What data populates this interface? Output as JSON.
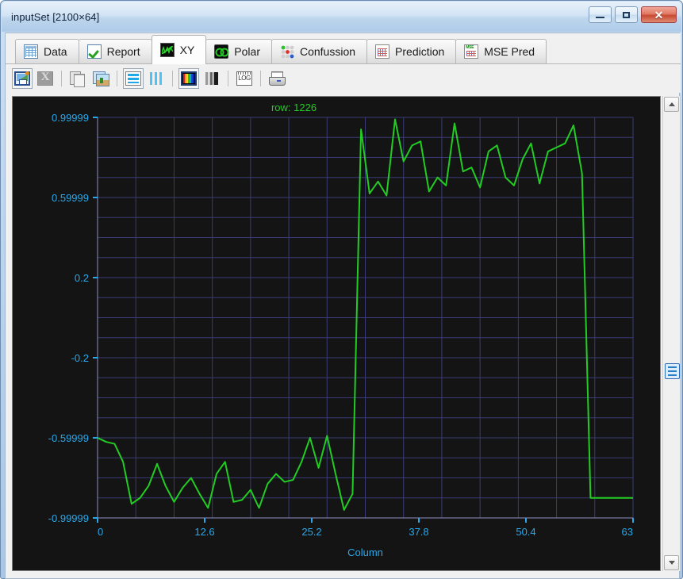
{
  "window": {
    "title": "inputSet [2100×64]",
    "buttons": [
      {
        "name": "minimize",
        "label": "Minimize",
        "glyph": "minimize-icon"
      },
      {
        "name": "maximize",
        "label": "Maximize",
        "glyph": "maximize-icon"
      },
      {
        "name": "close",
        "label": "Close",
        "glyph": "✕"
      }
    ]
  },
  "tabs": [
    {
      "label": "Data",
      "icon": "grid-table-icon",
      "active": false
    },
    {
      "label": "Report",
      "icon": "check-icon",
      "active": false
    },
    {
      "label": "XY",
      "icon": "waveform-icon",
      "active": true
    },
    {
      "label": "Polar",
      "icon": "polar-icon",
      "active": false
    },
    {
      "label": "Confussion",
      "icon": "confusion-dots-icon",
      "active": false
    },
    {
      "label": "Prediction",
      "icon": "prediction-grid-icon",
      "active": false
    },
    {
      "label": "MSE Pred",
      "icon": "mse-grid-icon",
      "active": false
    }
  ],
  "toolbar": {
    "buttons": [
      {
        "name": "save-image-button",
        "icon": "save-image-icon",
        "tooltip": "Save image"
      },
      {
        "name": "export-excel-button",
        "icon": "excel-icon",
        "tooltip": "Export to Excel",
        "disabled": true
      },
      {
        "name": "copy-button",
        "icon": "copy-icon",
        "tooltip": "Copy"
      },
      {
        "name": "copy-image-button",
        "icon": "copy-image-icon",
        "tooltip": "Copy image"
      },
      {
        "name": "rows-view-button",
        "icon": "horizontal-lines-icon",
        "tooltip": "Rows"
      },
      {
        "name": "columns-view-button",
        "icon": "vertical-bars-icon",
        "tooltip": "Columns"
      },
      {
        "name": "color-map-button",
        "icon": "color-bars-icon",
        "tooltip": "Color map",
        "selected": true
      },
      {
        "name": "gray-map-button",
        "icon": "gray-bars-icon",
        "tooltip": "Gray map"
      },
      {
        "name": "log-scale-button",
        "icon": "log-icon",
        "tooltip": "Log scale"
      },
      {
        "name": "print-button",
        "icon": "printer-icon",
        "tooltip": "Print"
      }
    ]
  },
  "scrollbar": {
    "up_arrow": "scroll-up-icon",
    "down_arrow": "scroll-down-icon",
    "thumb_marker": "row-marker-icon"
  },
  "chart_data": {
    "type": "line",
    "title": "row: 1226",
    "xlabel": "Column",
    "ylabel": "",
    "grid": true,
    "legend": null,
    "line_color": "#22cc22",
    "background_color": "#141414",
    "grid_color": "#3a3a78",
    "axis_text_color": "#29a8ea",
    "xlim": [
      0,
      63
    ],
    "ylim": [
      -0.99999,
      0.99999
    ],
    "xticks": [
      0,
      12.6,
      25.2,
      37.8,
      50.4,
      63
    ],
    "xtick_labels": [
      "0",
      "12.6",
      "25.2",
      "37.8",
      "50.4",
      "63"
    ],
    "yticks": [
      0.99999,
      0.59999,
      0.2,
      -0.2,
      -0.59999,
      -0.99999
    ],
    "ytick_labels": [
      "0.99999",
      "0.59999",
      "0.2",
      "-0.2",
      "-0.59999",
      "-0.99999"
    ],
    "x": [
      0,
      1,
      2,
      3,
      4,
      5,
      6,
      7,
      8,
      9,
      10,
      11,
      12,
      13,
      14,
      15,
      16,
      17,
      18,
      19,
      20,
      21,
      22,
      23,
      24,
      25,
      26,
      27,
      28,
      29,
      30,
      31,
      32,
      33,
      34,
      35,
      36,
      37,
      38,
      39,
      40,
      41,
      42,
      43,
      44,
      45,
      46,
      47,
      48,
      49,
      50,
      51,
      52,
      53,
      54,
      55,
      56,
      57,
      58,
      59,
      60,
      61,
      62,
      63
    ],
    "values": [
      -0.6,
      -0.62,
      -0.63,
      -0.72,
      -0.93,
      -0.9,
      -0.84,
      -0.73,
      -0.84,
      -0.92,
      -0.85,
      -0.8,
      -0.88,
      -0.95,
      -0.78,
      -0.72,
      -0.92,
      -0.91,
      -0.86,
      -0.95,
      -0.83,
      -0.78,
      -0.82,
      -0.81,
      -0.72,
      -0.6,
      -0.75,
      -0.59,
      -0.78,
      -0.96,
      -0.88,
      0.94,
      0.62,
      0.68,
      0.61,
      0.99,
      0.78,
      0.86,
      0.88,
      0.63,
      0.7,
      0.66,
      0.97,
      0.73,
      0.75,
      0.65,
      0.83,
      0.86,
      0.7,
      0.66,
      0.79,
      0.87,
      0.67,
      0.83,
      0.85,
      0.87,
      0.96,
      0.72,
      -0.9,
      -0.9,
      -0.9,
      -0.9,
      -0.9,
      -0.9
    ],
    "series": [
      {
        "name": "row 1226",
        "values": [
          -0.6,
          -0.62,
          -0.63,
          -0.72,
          -0.93,
          -0.9,
          -0.84,
          -0.73,
          -0.84,
          -0.92,
          -0.85,
          -0.8,
          -0.88,
          -0.95,
          -0.78,
          -0.72,
          -0.92,
          -0.91,
          -0.86,
          -0.95,
          -0.83,
          -0.78,
          -0.82,
          -0.81,
          -0.72,
          -0.6,
          -0.75,
          -0.59,
          -0.78,
          -0.96,
          -0.88,
          0.94,
          0.62,
          0.68,
          0.61,
          0.99,
          0.78,
          0.86,
          0.88,
          0.63,
          0.7,
          0.66,
          0.97,
          0.73,
          0.75,
          0.65,
          0.83,
          0.86,
          0.7,
          0.66,
          0.79,
          0.87,
          0.67,
          0.83,
          0.85,
          0.87,
          0.96,
          0.72,
          -0.9,
          -0.9,
          -0.9,
          -0.9,
          -0.9,
          -0.9
        ]
      }
    ]
  }
}
